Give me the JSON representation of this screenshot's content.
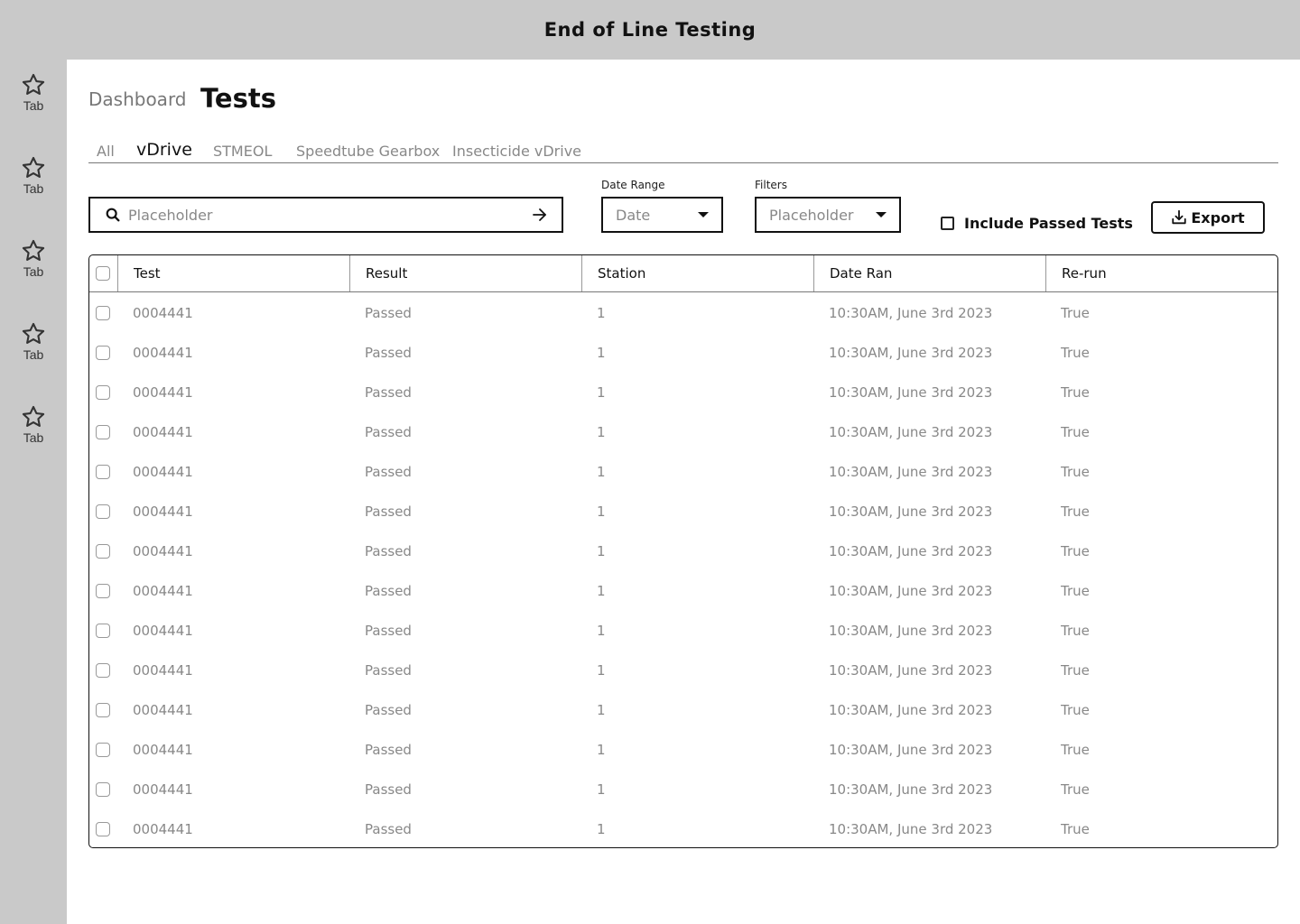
{
  "app": {
    "title": "End of Line Testing"
  },
  "sidebar": {
    "items": [
      {
        "label": "Tab",
        "icon": "star-icon"
      },
      {
        "label": "Tab",
        "icon": "star-icon"
      },
      {
        "label": "Tab",
        "icon": "star-icon"
      },
      {
        "label": "Tab",
        "icon": "star-icon"
      },
      {
        "label": "Tab",
        "icon": "star-icon"
      }
    ]
  },
  "breadcrumb": {
    "parent": "Dashboard",
    "current": "Tests"
  },
  "tabs": [
    {
      "label": "All",
      "active": false
    },
    {
      "label": "vDrive",
      "active": true
    },
    {
      "label": "STMEOL",
      "active": false
    },
    {
      "label": "Speedtube Gearbox",
      "active": false
    },
    {
      "label": "Insecticide vDrive",
      "active": false
    }
  ],
  "toolbar": {
    "search": {
      "placeholder": "Placeholder",
      "value": "",
      "icon": "search-icon",
      "submit_icon": "arrow-right-icon"
    },
    "date_range": {
      "label": "Date Range",
      "value": "Date"
    },
    "filters": {
      "label": "Filters",
      "value": "Placeholder"
    },
    "include_passed": {
      "label": "Include Passed Tests",
      "checked": false
    },
    "export": {
      "label": "Export",
      "icon": "download-icon"
    }
  },
  "table": {
    "columns": [
      "Test",
      "Result",
      "Station",
      "Date Ran",
      "Re-run"
    ],
    "rows": [
      {
        "test": "0004441",
        "result": "Passed",
        "station": "1",
        "date": "10:30AM, June 3rd 2023",
        "rerun": "True"
      },
      {
        "test": "0004441",
        "result": "Passed",
        "station": "1",
        "date": "10:30AM, June 3rd 2023",
        "rerun": "True"
      },
      {
        "test": "0004441",
        "result": "Passed",
        "station": "1",
        "date": "10:30AM, June 3rd 2023",
        "rerun": "True"
      },
      {
        "test": "0004441",
        "result": "Passed",
        "station": "1",
        "date": "10:30AM, June 3rd 2023",
        "rerun": "True"
      },
      {
        "test": "0004441",
        "result": "Passed",
        "station": "1",
        "date": "10:30AM, June 3rd 2023",
        "rerun": "True"
      },
      {
        "test": "0004441",
        "result": "Passed",
        "station": "1",
        "date": "10:30AM, June 3rd 2023",
        "rerun": "True"
      },
      {
        "test": "0004441",
        "result": "Passed",
        "station": "1",
        "date": "10:30AM, June 3rd 2023",
        "rerun": "True"
      },
      {
        "test": "0004441",
        "result": "Passed",
        "station": "1",
        "date": "10:30AM, June 3rd 2023",
        "rerun": "True"
      },
      {
        "test": "0004441",
        "result": "Passed",
        "station": "1",
        "date": "10:30AM, June 3rd 2023",
        "rerun": "True"
      },
      {
        "test": "0004441",
        "result": "Passed",
        "station": "1",
        "date": "10:30AM, June 3rd 2023",
        "rerun": "True"
      },
      {
        "test": "0004441",
        "result": "Passed",
        "station": "1",
        "date": "10:30AM, June 3rd 2023",
        "rerun": "True"
      },
      {
        "test": "0004441",
        "result": "Passed",
        "station": "1",
        "date": "10:30AM, June 3rd 2023",
        "rerun": "True"
      },
      {
        "test": "0004441",
        "result": "Passed",
        "station": "1",
        "date": "10:30AM, June 3rd 2023",
        "rerun": "True"
      },
      {
        "test": "0004441",
        "result": "Passed",
        "station": "1",
        "date": "10:30AM, June 3rd 2023",
        "rerun": "True"
      }
    ]
  }
}
